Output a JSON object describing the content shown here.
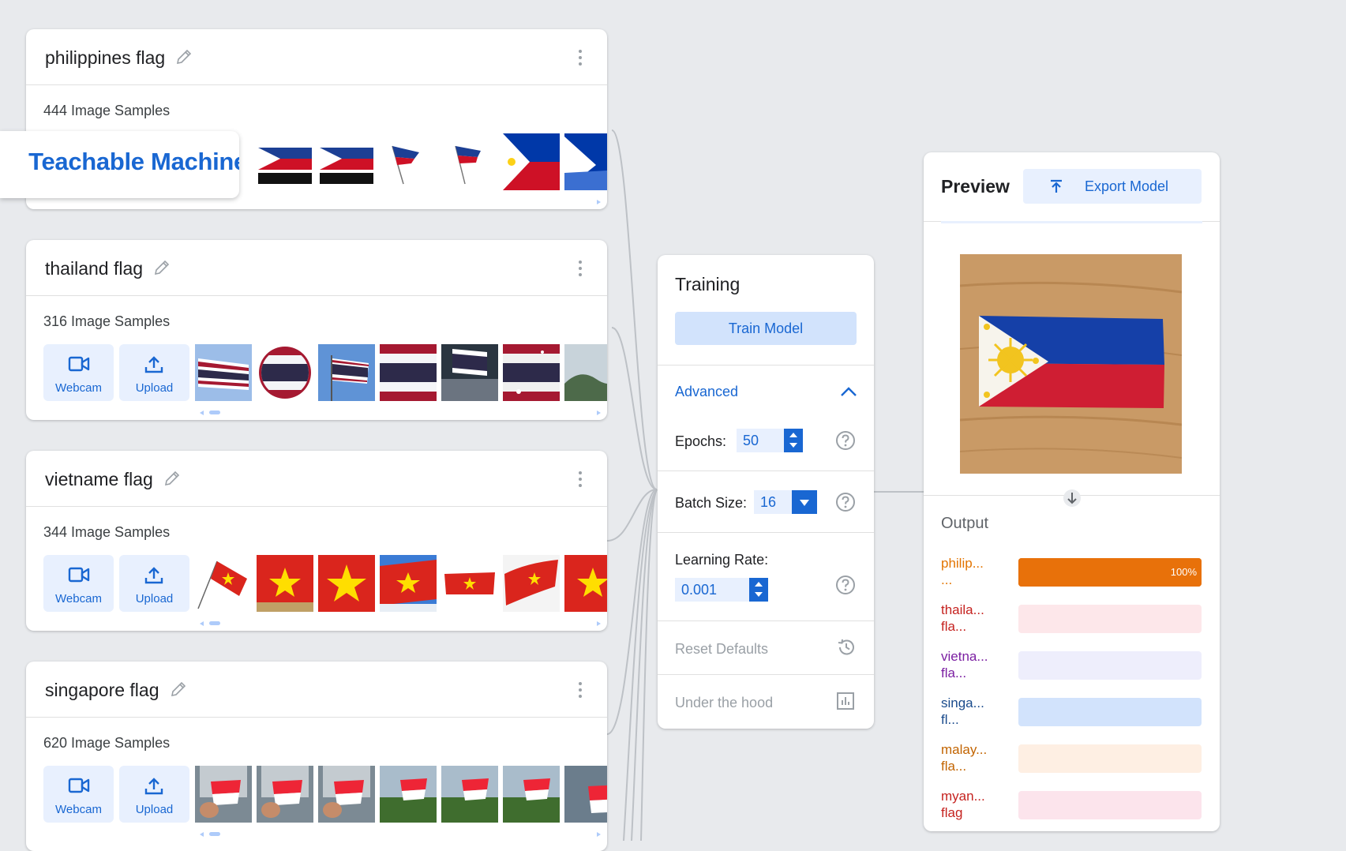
{
  "logo": {
    "text": "Teachable Machine"
  },
  "classes": [
    {
      "title": "philippines flag",
      "samples": "444 Image Samples"
    },
    {
      "title": "thailand flag",
      "samples": "316 Image Samples",
      "webcam": "Webcam",
      "upload": "Upload"
    },
    {
      "title": "vietname flag",
      "samples": "344 Image Samples",
      "webcam": "Webcam",
      "upload": "Upload"
    },
    {
      "title": "singapore flag",
      "samples": "620 Image Samples",
      "webcam": "Webcam",
      "upload": "Upload"
    }
  ],
  "training": {
    "title": "Training",
    "train_button": "Train Model",
    "advanced_label": "Advanced",
    "epochs_label": "Epochs:",
    "epochs_value": "50",
    "batch_size_label": "Batch Size:",
    "batch_size_value": "16",
    "learning_rate_label": "Learning Rate:",
    "learning_rate_value": "0.001",
    "reset_defaults": "Reset Defaults",
    "under_the_hood": "Under the hood"
  },
  "preview": {
    "title": "Preview",
    "export_button": "Export Model",
    "output_label": "Output",
    "outputs": [
      {
        "line1": "philip...",
        "line2": "...",
        "percent": 1.0,
        "percent_label": "100%",
        "text_color": "#e37400",
        "track_color": "#e8710a",
        "fill_color": "#e8710a"
      },
      {
        "line1": "thaila...",
        "line2": "fla...",
        "percent": 0,
        "percent_label": "",
        "text_color": "#c5221f",
        "track_color": "#fde7ea",
        "fill_color": "#d93025"
      },
      {
        "line1": "vietna...",
        "line2": "fla...",
        "percent": 0,
        "percent_label": "",
        "text_color": "#7b1fa2",
        "track_color": "#eeeefc",
        "fill_color": "#7b1fa2"
      },
      {
        "line1": "singa...",
        "line2": "fl...",
        "percent": 0,
        "percent_label": "",
        "text_color": "#1a4b8c",
        "track_color": "#d2e3fc",
        "fill_color": "#1967d2"
      },
      {
        "line1": "malay...",
        "line2": "fla...",
        "percent": 0,
        "percent_label": "",
        "text_color": "#c26401",
        "track_color": "#feefe3",
        "fill_color": "#e8710a"
      },
      {
        "line1": "myan...",
        "line2": "flag",
        "percent": 0,
        "percent_label": "",
        "text_color": "#c5221f",
        "track_color": "#fce4ec",
        "fill_color": "#d93025"
      }
    ]
  },
  "colors": {
    "accent": "#1967d2",
    "background": "#e8eaed"
  }
}
